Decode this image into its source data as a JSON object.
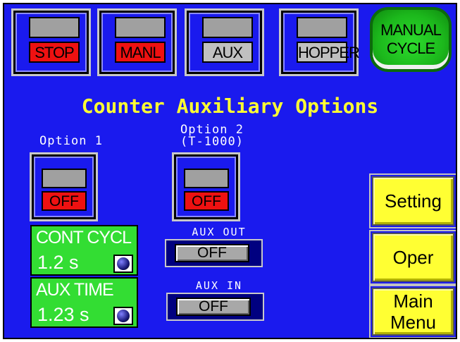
{
  "status_bar": {
    "stop_label": "STOP",
    "manl_label": "MANL",
    "aux_label": "AUX",
    "hopper_label": "HOPPER",
    "manual_cycle_label": "MANUAL\nCYCLE"
  },
  "title": "Counter Auxiliary Options",
  "option1": {
    "label": "Option 1",
    "state": "OFF"
  },
  "option2": {
    "label": "Option 2\n(T-1000)",
    "state": "OFF"
  },
  "cont_cycl": {
    "label": "CONT CYCL",
    "value": "1.2 s"
  },
  "aux_time": {
    "label": "AUX TIME",
    "value": "1.23 s"
  },
  "aux_out": {
    "label": "AUX OUT",
    "state": "OFF"
  },
  "aux_in": {
    "label": "AUX IN",
    "state": "OFF"
  },
  "nav": {
    "setting_label": "Setting",
    "oper_label": "Oper",
    "main_menu_label": "Main\nMenu"
  },
  "colors": {
    "background": "#1a1aee",
    "title": "#ffff33",
    "lamp_on": "#ee1111",
    "panel": "#33dd33",
    "nav_button": "#ffff33"
  }
}
